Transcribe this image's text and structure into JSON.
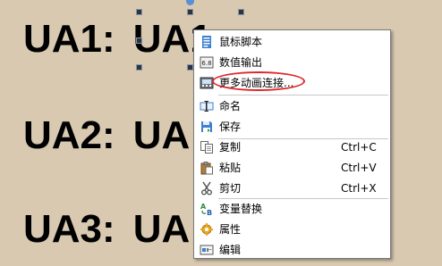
{
  "canvas": {
    "labels": [
      {
        "name": "UA1:",
        "value": "UA1"
      },
      {
        "name": "UA2:",
        "value": "UA"
      },
      {
        "name": "UA3:",
        "value": "UA"
      }
    ]
  },
  "context_menu": {
    "items": [
      {
        "label": "鼠标脚本",
        "shortcut": "",
        "icon": "script-icon"
      },
      {
        "label": "数值输出",
        "shortcut": "",
        "icon": "numeric-display-icon"
      },
      {
        "label": "更多动画连接...",
        "shortcut": "",
        "icon": "animation-link-icon"
      },
      {
        "label": "命名",
        "shortcut": "",
        "icon": "rename-icon"
      },
      {
        "label": "保存",
        "shortcut": "",
        "icon": "save-icon"
      },
      {
        "label": "复制",
        "shortcut": "Ctrl+C",
        "icon": "copy-icon"
      },
      {
        "label": "粘贴",
        "shortcut": "Ctrl+V",
        "icon": "paste-icon"
      },
      {
        "label": "剪切",
        "shortcut": "Ctrl+X",
        "icon": "cut-icon"
      },
      {
        "label": "变量替换",
        "shortcut": "",
        "icon": "variable-replace-icon"
      },
      {
        "label": "属性",
        "shortcut": "",
        "icon": "properties-icon"
      },
      {
        "label": "编辑",
        "shortcut": "",
        "icon": "edit-icon"
      }
    ]
  },
  "colors": {
    "canvas_background": "#d8c9b0",
    "annotation_circle": "#e0262b",
    "selection_handle": "#2b3540"
  }
}
